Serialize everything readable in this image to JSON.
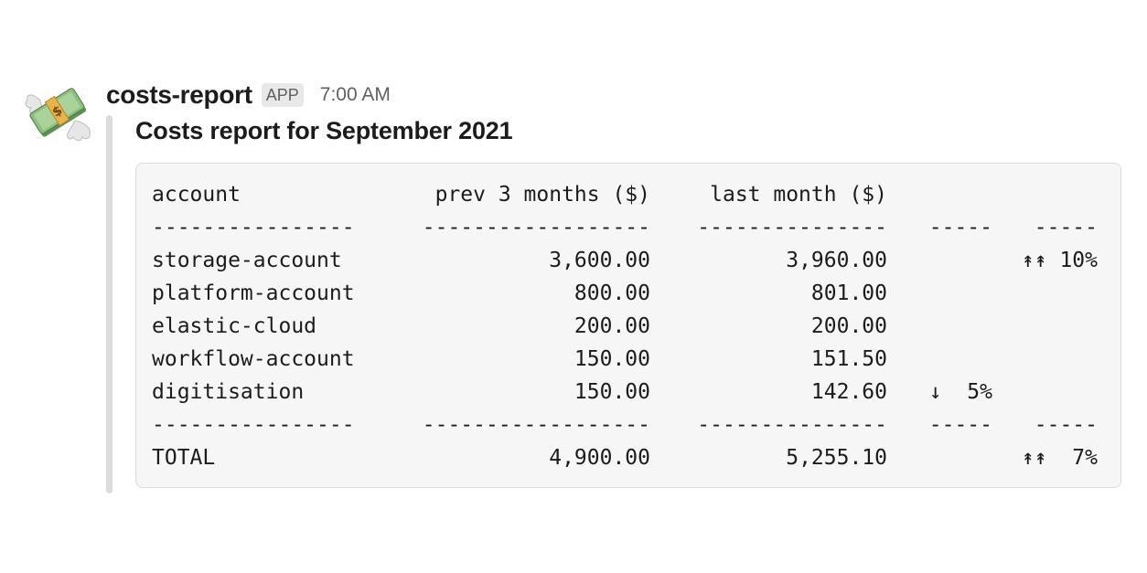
{
  "message": {
    "sender": "costs-report",
    "badge": "APP",
    "timestamp": "7:00 AM",
    "avatar_icon": "money-with-wings-icon",
    "title": "Costs report for September 2021"
  },
  "table": {
    "headers": {
      "account": "account",
      "prev": "prev 3 months ($)",
      "last": "last month ($)"
    },
    "separator": {
      "account": "----------------",
      "prev": "------------------",
      "last": "---------------",
      "down": "-----",
      "up": "-----"
    },
    "rows": [
      {
        "account": "storage-account",
        "prev": "3,600.00",
        "last": "3,960.00",
        "down": "",
        "up": "↟↟ 10%"
      },
      {
        "account": "platform-account",
        "prev": "800.00",
        "last": "801.00",
        "down": "",
        "up": ""
      },
      {
        "account": "elastic-cloud",
        "prev": "200.00",
        "last": "200.00",
        "down": "",
        "up": ""
      },
      {
        "account": "workflow-account",
        "prev": "150.00",
        "last": "151.50",
        "down": "",
        "up": ""
      },
      {
        "account": "digitisation",
        "prev": "150.00",
        "last": "142.60",
        "down": "↓  5%",
        "up": ""
      }
    ],
    "total": {
      "account": "TOTAL",
      "prev": "4,900.00",
      "last": "5,255.10",
      "down": "",
      "up": "↟↟  7%"
    }
  }
}
